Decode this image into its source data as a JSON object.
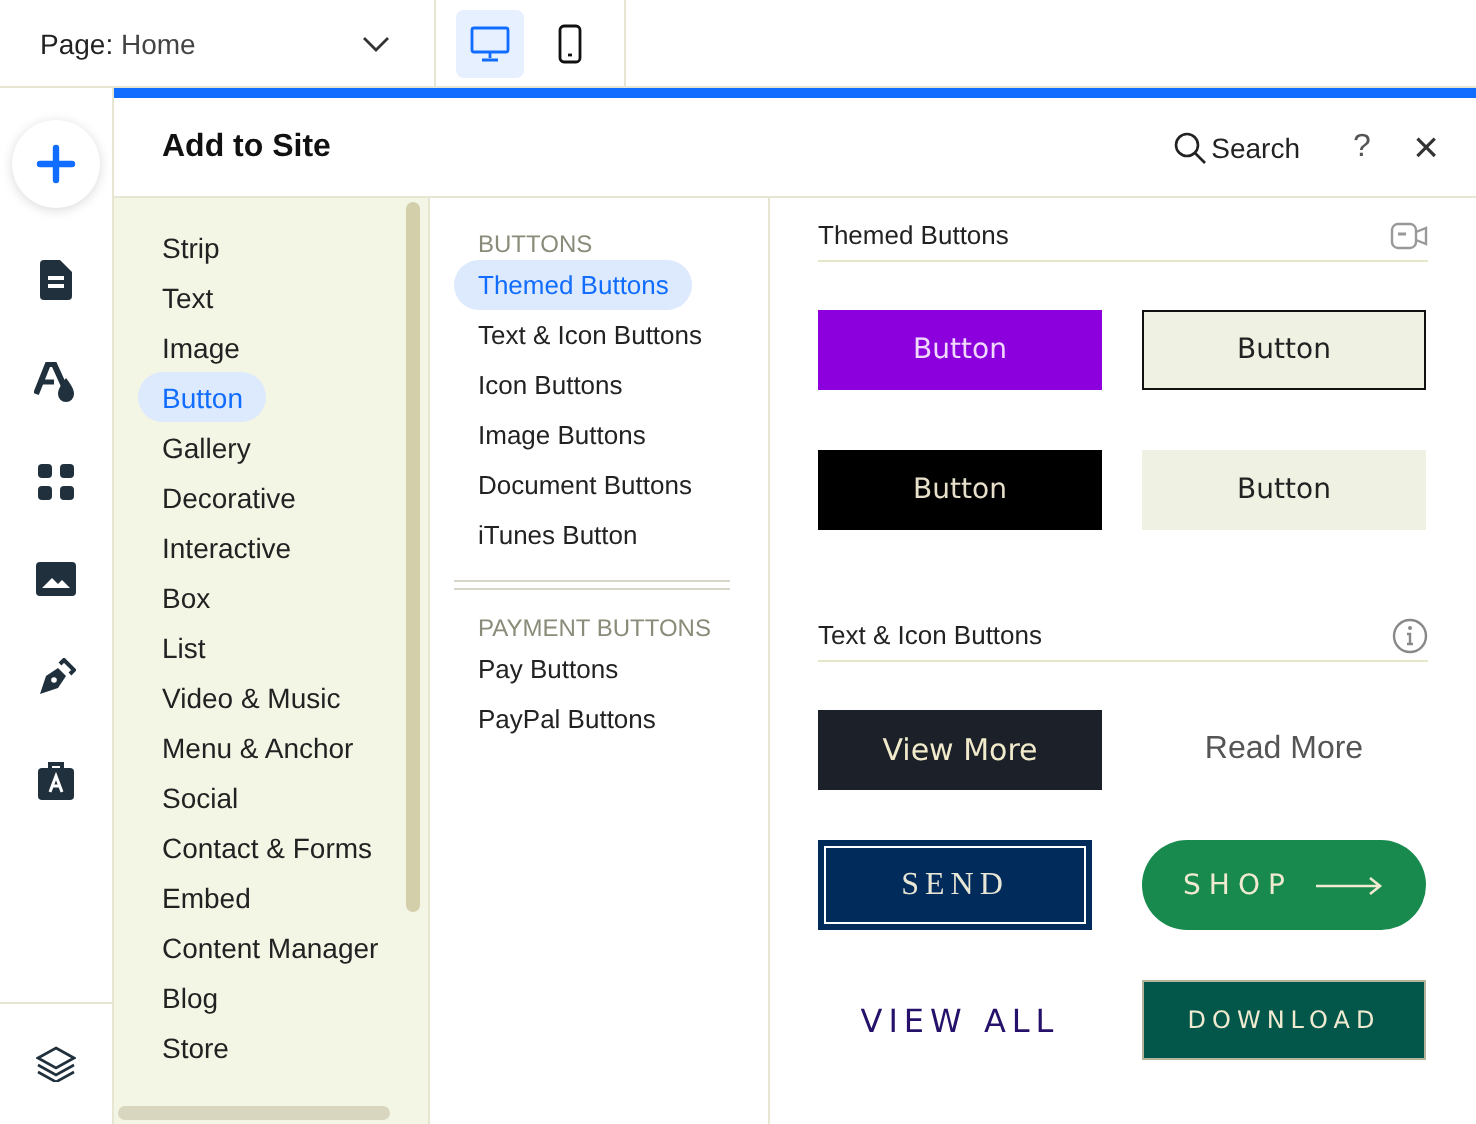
{
  "top_bar": {
    "page_label": "Page:",
    "page_name": "Home",
    "devices": [
      {
        "kind": "desktop",
        "selected": true
      },
      {
        "kind": "mobile",
        "selected": false
      }
    ]
  },
  "panel": {
    "title": "Add to Site",
    "search": "Search",
    "help": "?",
    "close": "×"
  },
  "categories": [
    {
      "label": "Strip",
      "selected": false
    },
    {
      "label": "Text",
      "selected": false
    },
    {
      "label": "Image",
      "selected": false
    },
    {
      "label": "Button",
      "selected": true
    },
    {
      "label": "Gallery",
      "selected": false
    },
    {
      "label": "Decorative",
      "selected": false
    },
    {
      "label": "Interactive",
      "selected": false
    },
    {
      "label": "Box",
      "selected": false
    },
    {
      "label": "List",
      "selected": false
    },
    {
      "label": "Video & Music",
      "selected": false
    },
    {
      "label": "Menu & Anchor",
      "selected": false
    },
    {
      "label": "Social",
      "selected": false
    },
    {
      "label": "Contact & Forms",
      "selected": false
    },
    {
      "label": "Embed",
      "selected": false
    },
    {
      "label": "Content Manager",
      "selected": false
    },
    {
      "label": "Blog",
      "selected": false
    },
    {
      "label": "Store",
      "selected": false
    }
  ],
  "subcategory_groups": [
    {
      "heading": "BUTTONS",
      "items": [
        {
          "label": "Themed Buttons",
          "selected": true
        },
        {
          "label": "Text & Icon Buttons",
          "selected": false
        },
        {
          "label": "Icon Buttons",
          "selected": false
        },
        {
          "label": "Image Buttons",
          "selected": false
        },
        {
          "label": "Document Buttons",
          "selected": false
        },
        {
          "label": "iTunes Button",
          "selected": false
        }
      ]
    },
    {
      "heading": "PAYMENT BUTTONS",
      "items": [
        {
          "label": "Pay Buttons",
          "selected": false
        },
        {
          "label": "PayPal Buttons",
          "selected": false
        }
      ]
    }
  ],
  "sections": [
    {
      "title": "Themed Buttons",
      "kind": "video",
      "buttons": [
        {
          "label": "Button",
          "kind": "purple"
        },
        {
          "label": "Button",
          "kind": "outlined"
        },
        {
          "label": "Button",
          "kind": "black"
        },
        {
          "label": "Button",
          "kind": "light"
        }
      ]
    },
    {
      "title": "Text & Icon Buttons",
      "kind": "info",
      "buttons": [
        {
          "label": "View More",
          "kind": "dark"
        },
        {
          "label": "Read More",
          "kind": "plain"
        },
        {
          "label": "SEND",
          "kind": "framed"
        },
        {
          "label": "SHOP",
          "kind": "arrow"
        },
        {
          "label": "VIEW ALL",
          "kind": "spaced"
        },
        {
          "label": "DOWNLOAD",
          "kind": "teal"
        }
      ]
    }
  ]
}
